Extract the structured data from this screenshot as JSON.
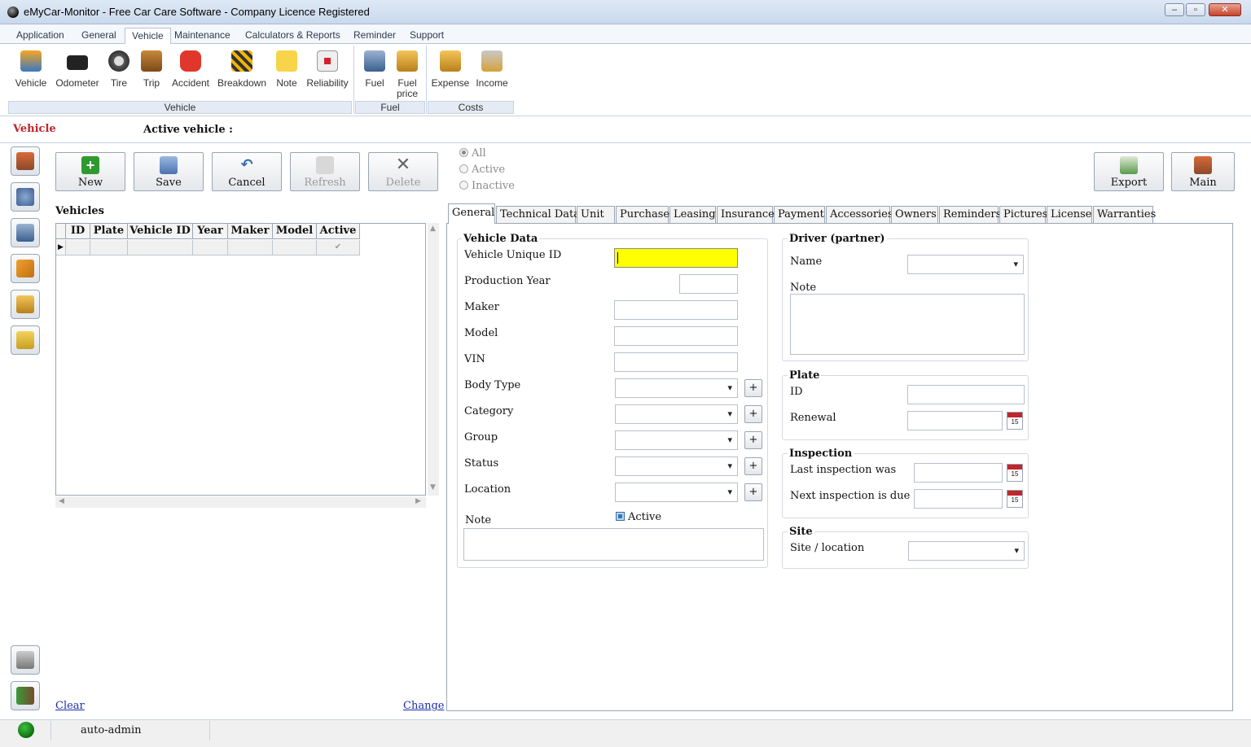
{
  "window": {
    "title": "eMyCar-Monitor - Free Car Care Software - Company Licence Registered",
    "minimize": "–",
    "maximize": "▫",
    "close": "✕"
  },
  "menu_tabs": [
    "Application",
    "General",
    "Vehicle",
    "Maintenance",
    "Calculators & Reports",
    "Reminder",
    "Support"
  ],
  "ribbon": {
    "vehicle_group": {
      "label": "Vehicle",
      "items": [
        "Vehicle",
        "Odometer",
        "Tire",
        "Trip",
        "Accident",
        "Breakdown",
        "Note",
        "Reliability"
      ]
    },
    "fuel_group": {
      "label": "Fuel",
      "items": [
        "Fuel",
        "Fuel\nprice"
      ]
    },
    "costs_group": {
      "label": "Costs",
      "items": [
        "Expense",
        "Income"
      ]
    }
  },
  "section": {
    "title": "Vehicle",
    "active_vehicle_label": "Active vehicle :"
  },
  "toolbar": {
    "new": "New",
    "save": "Save",
    "cancel": "Cancel",
    "refresh": "Refresh",
    "delete": "Delete",
    "export": "Export",
    "main": "Main"
  },
  "filter": {
    "all": "All",
    "active": "Active",
    "inactive": "Inactive"
  },
  "grid": {
    "title": "Vehicles",
    "columns": [
      "ID",
      "Plate",
      "Vehicle ID",
      "Year",
      "Maker",
      "Model",
      "Active"
    ],
    "active_check": "✔"
  },
  "links": {
    "clear": "Clear",
    "change": "Change"
  },
  "form_tabs": [
    "General",
    "Technical Data",
    "Unit",
    "Purchase",
    "Leasing",
    "Insurance",
    "Payment",
    "Accessories",
    "Owners",
    "Reminders",
    "Pictures",
    "License",
    "Warranties"
  ],
  "vehicle_data": {
    "title": "Vehicle Data",
    "unique_id": "Vehicle Unique ID",
    "production_year": "Production Year",
    "maker": "Maker",
    "model": "Model",
    "vin": "VIN",
    "body_type": "Body Type",
    "category": "Category",
    "group": "Group",
    "status": "Status",
    "location": "Location",
    "note": "Note",
    "active": "Active",
    "plus": "+"
  },
  "driver": {
    "title": "Driver (partner)",
    "name": "Name",
    "note": "Note"
  },
  "plate": {
    "title": "Plate",
    "id": "ID",
    "renewal": "Renewal",
    "cal": "15"
  },
  "inspection": {
    "title": "Inspection",
    "last": "Last inspection was",
    "next": "Next inspection is due"
  },
  "site": {
    "title": "Site",
    "location": "Site / location"
  },
  "status": {
    "user": "auto-admin"
  },
  "colors": {
    "accent_red": "#c0262b",
    "required_field": "#ffff00",
    "status_ok": "#1f9a1f"
  }
}
